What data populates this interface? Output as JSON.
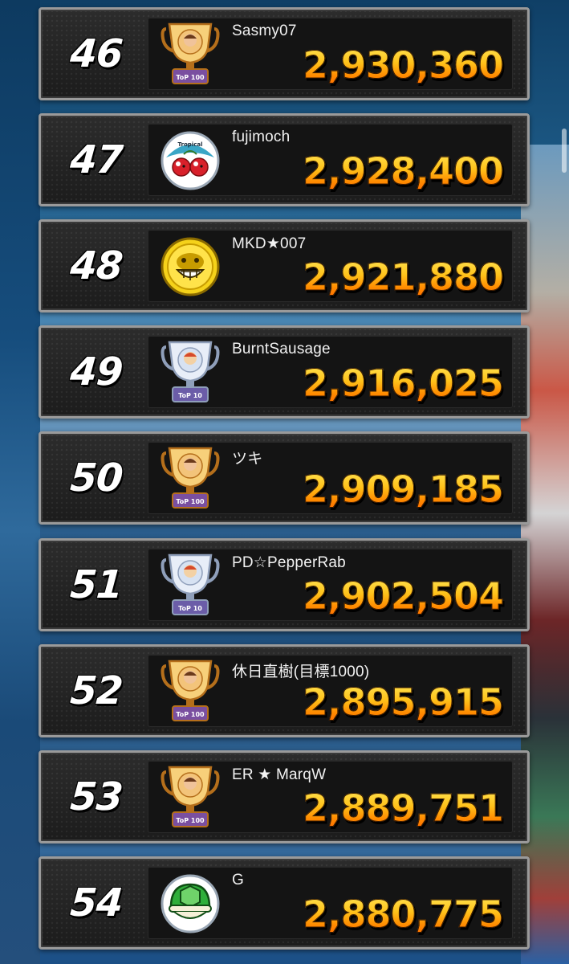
{
  "rows": [
    {
      "rank": "46",
      "name": "Sasmy07",
      "score": "2,930,360",
      "avatar": "trophy-gold-top100",
      "trophy_label": "ToP 100"
    },
    {
      "rank": "47",
      "name": "fujimoch",
      "score": "2,928,400",
      "avatar": "cherry-emblem",
      "emblem_text": "Tropical"
    },
    {
      "rank": "48",
      "name": "MKD★007",
      "score": "2,921,880",
      "avatar": "donkey-kong-coin"
    },
    {
      "rank": "49",
      "name": "BurntSausage",
      "score": "2,916,025",
      "avatar": "trophy-silver-top10",
      "trophy_label": "ToP 10"
    },
    {
      "rank": "50",
      "name": "ツキ",
      "score": "2,909,185",
      "avatar": "trophy-gold-top100",
      "trophy_label": "ToP 100"
    },
    {
      "rank": "51",
      "name": "PD☆PepperRab",
      "score": "2,902,504",
      "avatar": "trophy-silver-top10",
      "trophy_label": "ToP 10"
    },
    {
      "rank": "52",
      "name": "休日直樹(目標1000)",
      "score": "2,895,915",
      "avatar": "trophy-gold-top100",
      "trophy_label": "ToP 100"
    },
    {
      "rank": "53",
      "name": "ER ★ MarqW",
      "score": "2,889,751",
      "avatar": "trophy-gold-top100",
      "trophy_label": "ToP 100"
    },
    {
      "rank": "54",
      "name": "G",
      "score": "2,880,775",
      "avatar": "green-shell-emblem"
    }
  ],
  "colors": {
    "score_top": "#ffe95a",
    "score_bottom": "#ff6a00",
    "row_bg": "#232323",
    "row_border": "#9a9a9a",
    "trophy_gold": "#e0a233",
    "trophy_silver": "#b8c6dc"
  }
}
